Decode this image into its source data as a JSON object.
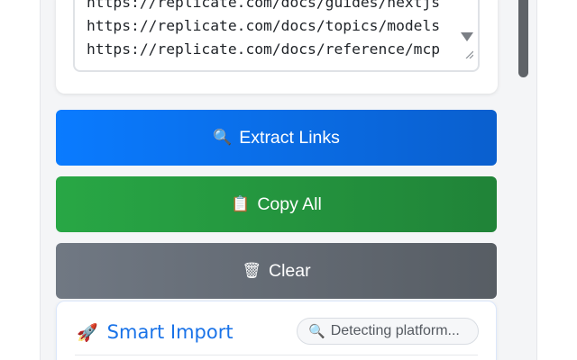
{
  "links": [
    "https://replicate.com/docs/guides/nextjs",
    "https://replicate.com/docs/topics/models",
    "https://replicate.com/docs/reference/mcp"
  ],
  "buttons": {
    "extract": {
      "icon": "🔍",
      "icon_name": "magnifier-icon",
      "label": "Extract Links",
      "color": "#0a7bff"
    },
    "copy": {
      "icon": "📋",
      "icon_name": "clipboard-icon",
      "label": "Copy All",
      "color": "#28a745"
    },
    "clear": {
      "icon": "🗑",
      "icon_name": "wastebasket-icon",
      "label": "Clear",
      "color": "#6c757d"
    }
  },
  "smart_import": {
    "icon": "🚀",
    "icon_name": "rocket-icon",
    "title": "Smart Import",
    "title_color": "#1a73e8",
    "status_icon": "🔍",
    "status_icon_name": "magnifier-icon",
    "status": "Detecting platform..."
  }
}
